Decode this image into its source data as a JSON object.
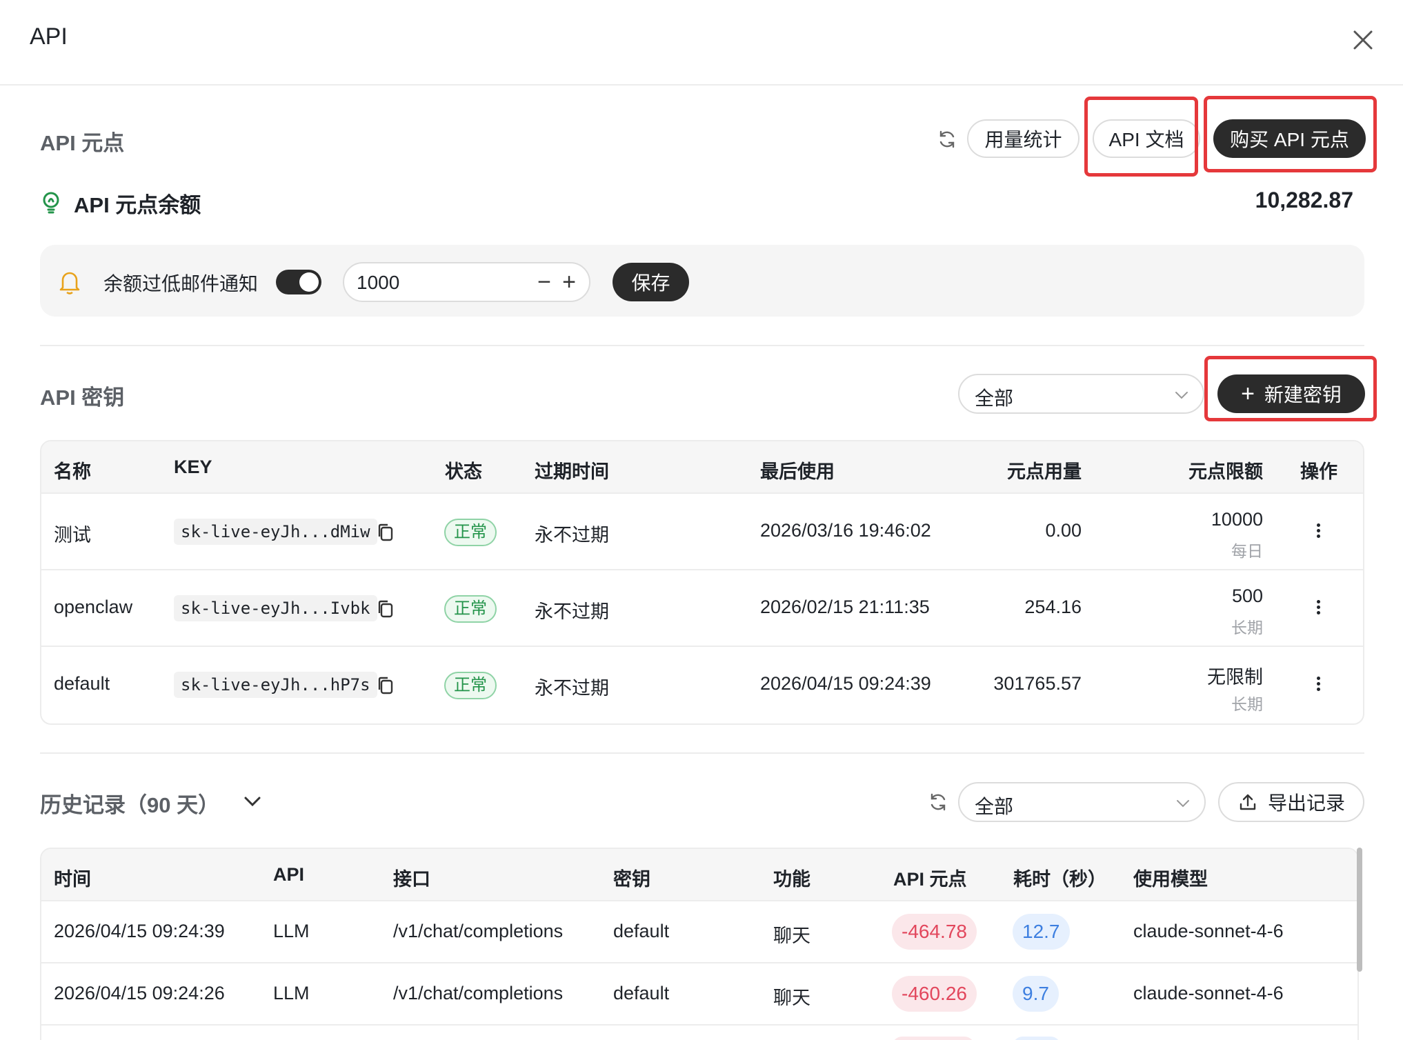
{
  "dialog": {
    "title": "API"
  },
  "points": {
    "section_title": "API 元点",
    "usage_button": "用量统计",
    "docs_button": "API 文档",
    "buy_button": "购买 API 元点",
    "balance_label": "API 元点余额",
    "balance_value": "10,282.87"
  },
  "notify": {
    "label": "余额过低邮件通知",
    "enabled": true,
    "threshold": "1000",
    "save_button": "保存"
  },
  "keys": {
    "section_title": "API 密钥",
    "filter_value": "全部",
    "new_button": "新建密钥",
    "columns": [
      "名称",
      "KEY",
      "状态",
      "过期时间",
      "最后使用",
      "元点用量",
      "元点限额",
      "操作"
    ],
    "rows": [
      {
        "name": "测试",
        "key": "sk-live-eyJh...dMiw",
        "status": "正常",
        "expire": "永不过期",
        "last_used": "2026/03/16 19:46:02",
        "usage": "0.00",
        "limit": "10000",
        "limit_period": "每日"
      },
      {
        "name": "openclaw",
        "key": "sk-live-eyJh...Ivbk",
        "status": "正常",
        "expire": "永不过期",
        "last_used": "2026/02/15 21:11:35",
        "usage": "254.16",
        "limit": "500",
        "limit_period": "长期"
      },
      {
        "name": "default",
        "key": "sk-live-eyJh...hP7s",
        "status": "正常",
        "expire": "永不过期",
        "last_used": "2026/04/15 09:24:39",
        "usage": "301765.57",
        "limit": "无限制",
        "limit_period": "长期"
      }
    ]
  },
  "history": {
    "section_title": "历史记录（90 天）",
    "filter_value": "全部",
    "export_button": "导出记录",
    "columns": [
      "时间",
      "API",
      "接口",
      "密钥",
      "功能",
      "API 元点",
      "耗时（秒）",
      "使用模型"
    ],
    "rows": [
      {
        "time": "2026/04/15 09:24:39",
        "api": "LLM",
        "endpoint": "/v1/chat/completions",
        "key": "default",
        "feature": "聊天",
        "points": "-464.78",
        "duration": "12.7",
        "model": "claude-sonnet-4-6"
      },
      {
        "time": "2026/04/15 09:24:26",
        "api": "LLM",
        "endpoint": "/v1/chat/completions",
        "key": "default",
        "feature": "聊天",
        "points": "-460.26",
        "duration": "9.7",
        "model": "claude-sonnet-4-6"
      }
    ]
  },
  "colors": {
    "accent_dark": "#2b2b2b",
    "highlight_red": "#e5383b",
    "status_green": "#23944a",
    "negative_red": "#e2465c",
    "duration_blue": "#3d7fe0"
  }
}
